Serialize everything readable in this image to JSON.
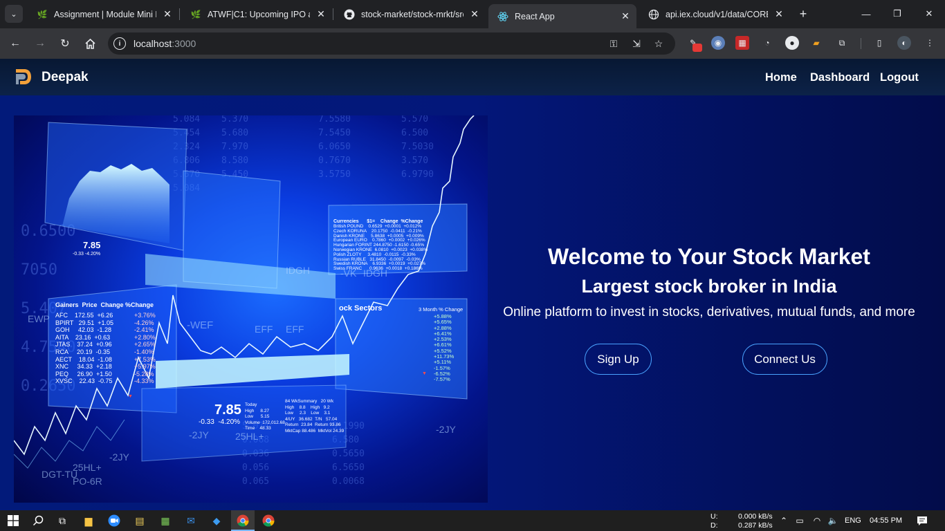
{
  "browser": {
    "tabs": [
      {
        "title": "Assignment | Module Mini P",
        "favicon": "leaf-icon"
      },
      {
        "title": "ATWF|C1: Upcoming IPO and",
        "favicon": "leaf-icon"
      },
      {
        "title": "stock-market/stock-mrkt/src",
        "favicon": "github-icon"
      },
      {
        "title": "React App",
        "favicon": "react-icon"
      },
      {
        "title": "api.iex.cloud/v1/data/CORE/",
        "favicon": "globe-icon"
      }
    ],
    "url_host": "localhost",
    "url_port": ":3000"
  },
  "navbar": {
    "brand": "Deepak",
    "links": [
      "Home",
      "Dashboard",
      "Logout"
    ]
  },
  "hero": {
    "title": "Welcome to Your Stock Market",
    "subtitle": "Largest stock broker in India",
    "description": "Online platform to invest in stocks, derivatives, mutual funds, and more",
    "signup_label": "Sign Up",
    "connect_label": "Connect Us"
  },
  "image_text": {
    "gainers_header": "Gainers  Price  Change %Change",
    "gainers_rows": "AFC    172.55  +6.26\nBPIRT   29.51  +1.05\nGOH     42.03  -1.28\nAITA    23.16  +0.63\nJTAS    37.24  +0.96\nRCA     20.19  -0.35\nAECT    18.04  -1.08\nXNC     34.33  +2.18\nPEQ     26.90  +1.50\nXVSC    22.43  -0.75",
    "pct_changes": "+3.76%\n-4.26%\n-2.41%\n+2.80%\n+2.65%\n-1.40%\n+7.53%\n+5.97%\n-5.28%\n-4.33%",
    "currencies_header": "Currencies      $1=    Change  %Change",
    "currencies_rows": "British POUND    0.6529  +0.0001  +0.012%\nCzech KORUNA    20.1750  -0.0411  -0.21%\nDanish KRONE     5.8638  +0.0005  +0.009%\nEuropean EURO    0.7860  +0.0002  +0.026%\nHungarian FORINT 244.8750 -1.6150 -0.65%\nNorwegian KRONE  6.0810  +0.0023  +0.038%\nPolish ZLOTY     3.4810  -0.0115  -0.33%\nRussian RUBLE   31.8450  -0.0097  -0.03%\nSwedish KRONA    6.9336  +0.0019  +0.027%\nSwiss FRANC      0.9636  +0.0018  +0.186%",
    "sectors_title": "ock Sectors",
    "sectors_header": "3 Month % Change",
    "sectors_rows": "+5.88%\n+5.65%\n+2.88%\n+6.41%\n+2.53%\n+6.61%\n+5.52%\n+11.73%\n+5.11%\n-1.57%\n-6.52%\n-7.57%",
    "quote_price": "7.85",
    "quote_change": "-0.33  -4.20%",
    "quote_price_small": "7.85",
    "quote_change_small": "-0.33 -4.20%",
    "today_block": "Today\nHigh     8.27\nLow      5.15\nVolume  172,012.68\nTime    48.33",
    "summary_block": "84 WkSummary   20 Wk\nHigh    8.8    High   9.2\nLow     2.3    Low    3.1\n4/UY   36.682  T/N   57.04\nReturn  23.84  Return 93.86\nMktCap 88.486  MktVol 24.39",
    "ticker_words": [
      "-WEF",
      "EFF",
      "EFF",
      "IDGH",
      "-VK",
      "IDGH",
      "25HL+",
      "-2JY",
      "-2JY",
      "DGT-TU",
      "25HL+",
      "PO-6R",
      "-2JY",
      "-2JY",
      "EWP",
      "-WEF"
    ],
    "left_numbers": "0.6500\n7050\n5.407\n4.7540\n0.2650"
  },
  "taskbar": {
    "net_up": "U:",
    "net_down": "D:",
    "net_up_val": "0.000 kB/s",
    "net_down_val": "0.287 kB/s",
    "lang": "ENG",
    "time": "04:55 PM"
  },
  "colors": {
    "page_bg": "#03177a",
    "navbar_bg": "#0c2248",
    "cta_border": "#4aa3ff"
  }
}
